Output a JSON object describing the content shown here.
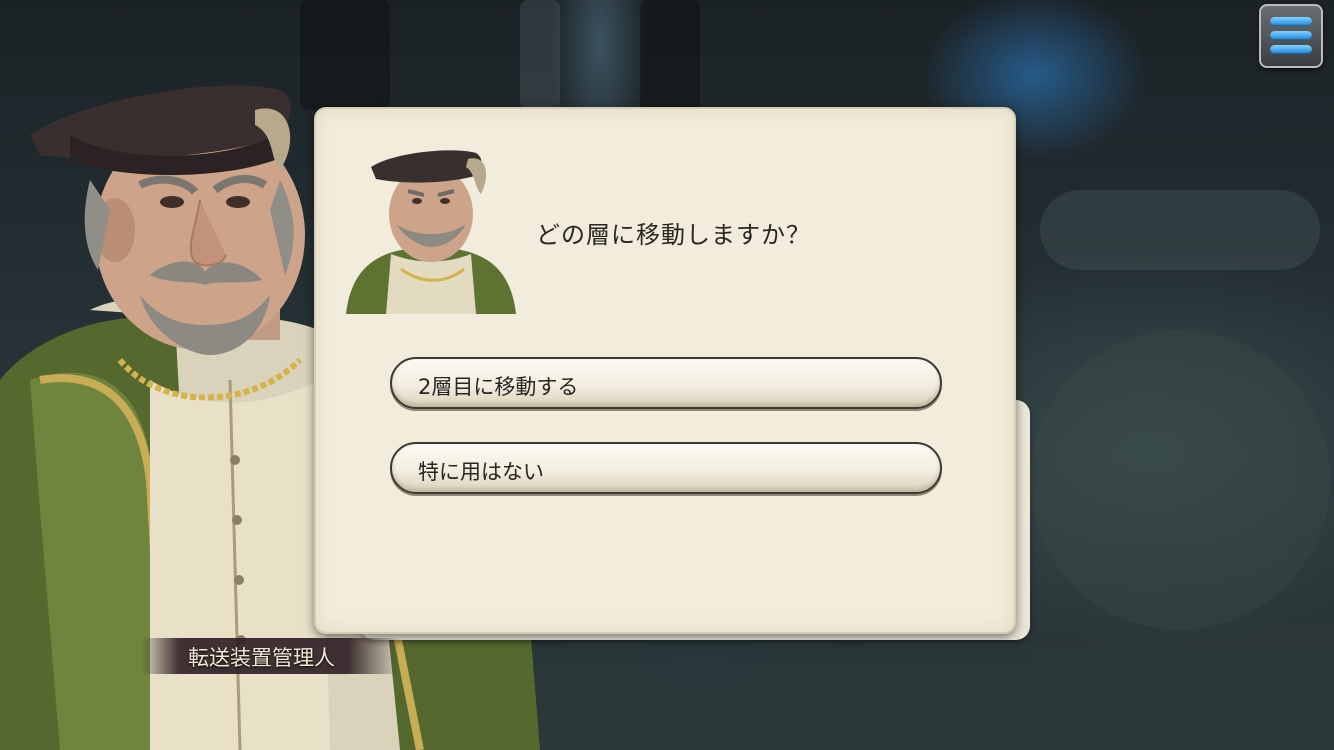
{
  "dialog": {
    "question": "どの層に移動しますか？",
    "choices": [
      {
        "label": "2層目に移動する"
      },
      {
        "label": "特に用はない"
      }
    ]
  },
  "speaker": {
    "name": "転送装置管理人"
  },
  "menu": {
    "icon": "hamburger-menu-icon",
    "accent": "#2a90e0"
  }
}
